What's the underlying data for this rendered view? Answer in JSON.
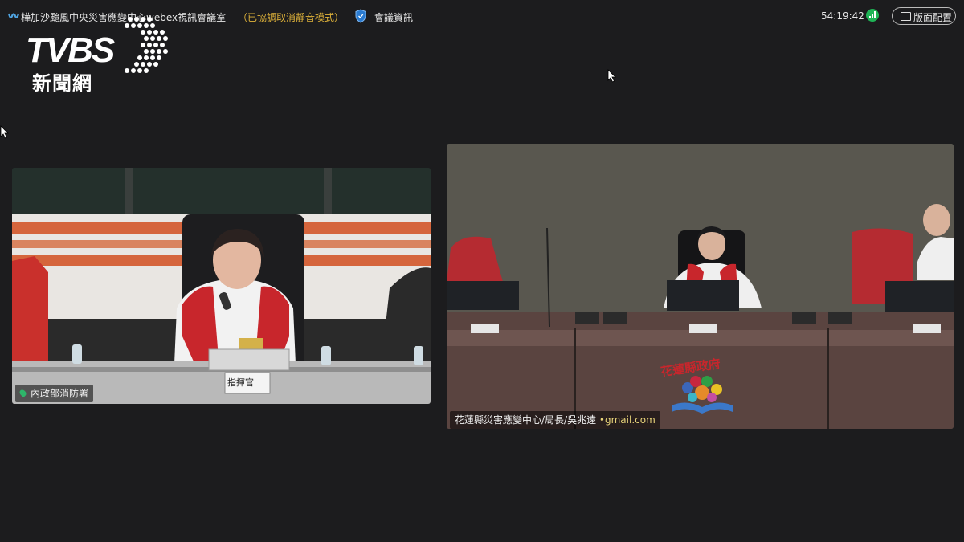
{
  "topbar": {
    "title": "樺加沙颱風中央災害應變中心webex視訊會議室",
    "mute_status": "（已協調取消靜音模式）",
    "meeting_info": "會議資訊",
    "timer": "54:19:42",
    "layout_button": "版面配置"
  },
  "brand": {
    "logo_text": "TVBS",
    "subtitle": "新聞網"
  },
  "participants": [
    {
      "name": "內政部消防署",
      "placard": "指揮官"
    },
    {
      "name": "花蓮縣災害應變中心/局長/吳兆遠 ",
      "email": "•gmail.com",
      "emblem_text": "花蓮縣政府"
    }
  ],
  "colors": {
    "background": "#1c1c1e",
    "accent_warning": "#e0b33a",
    "signal_good": "#1fb456",
    "vest_red": "#c8262c"
  }
}
